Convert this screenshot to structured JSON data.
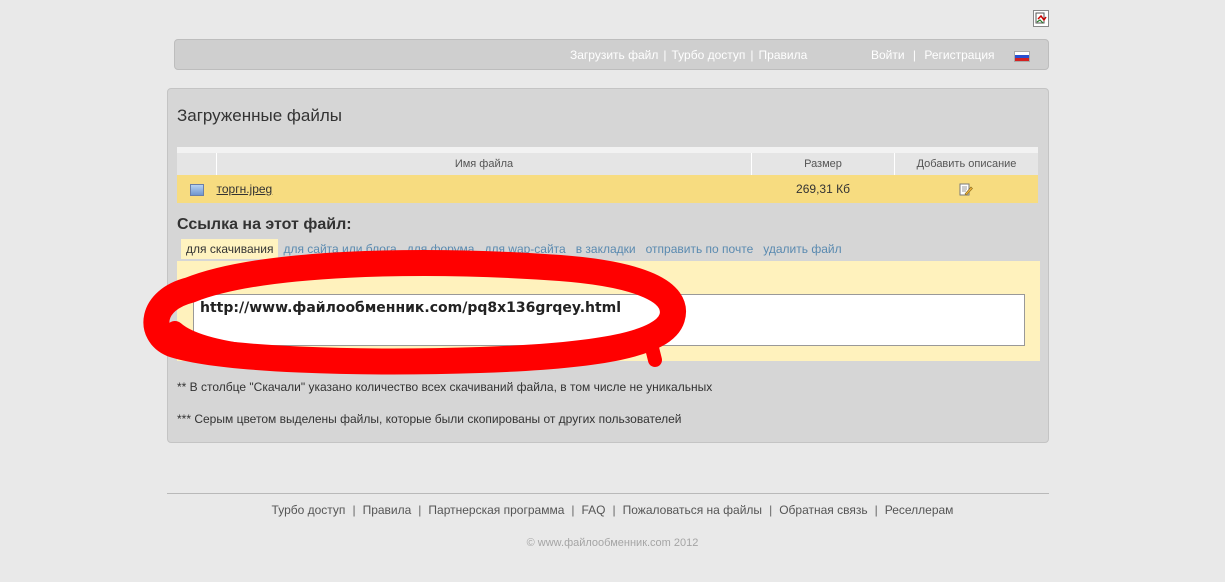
{
  "nav": {
    "left": [
      "Загрузить файл",
      "Турбо доступ",
      "Правила"
    ],
    "right": [
      "Войти",
      "Регистрация"
    ]
  },
  "panel": {
    "title": "Загруженные файлы",
    "table": {
      "headers": [
        "Имя файла",
        "Размер",
        "Добавить описание"
      ],
      "rows": [
        {
          "name": "торгн.jpeg",
          "size": "269,31 Кб"
        }
      ]
    },
    "link_label": "Ссылка на этот файл:",
    "tabs": [
      "для скачивания",
      "для сайта или блога",
      "для форума",
      "для wap-сайта",
      "в закладки",
      "отправить по почте",
      "удалить файл"
    ],
    "url": "http://www.файлообменник.com/pq8x136grqey.html",
    "notes": [
      "** В столбце \"Скачали\" указано количество всех скачиваний файла, в том числе не уникальных",
      "*** Серым цветом выделены файлы, которые были скопированы от других пользователей"
    ]
  },
  "footer": {
    "links": [
      "Турбо доступ",
      "Правила",
      "Партнерская программа",
      "FAQ",
      "Пожаловаться на файлы",
      "Обратная связь",
      "Реселлерам"
    ],
    "copyright": "© www.файлообменник.com 2012"
  },
  "colors": {
    "background": "#e9e9e9",
    "highlight_row": "#f7dc80",
    "tab_content": "#fff2bd",
    "scribble": "#ff0000"
  }
}
